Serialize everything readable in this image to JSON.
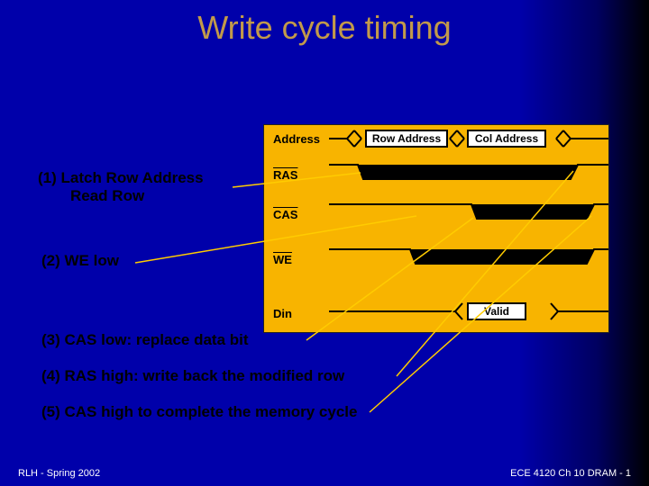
{
  "title": "Write cycle timing",
  "signals": {
    "address": "Address",
    "row_addr_box": "Row Address",
    "col_addr_box": "Col Address",
    "ras": "RAS",
    "cas": "CAS",
    "we": "WE",
    "din": "Din",
    "valid_box": "Valid"
  },
  "annotations": {
    "a1_main": "(1) Latch Row Address",
    "a1_sub": "Read Row",
    "a2": "(2) WE low",
    "a3": "(3) CAS low: replace data bit",
    "a4": "(4) RAS high: write back the modified row",
    "a5": "(5) CAS high to complete the memory cycle"
  },
  "footer": {
    "left": "RLH - Spring 2002",
    "right": "ECE 4120 Ch 10 DRAM - 1"
  },
  "chart_data": {
    "type": "timing-diagram",
    "signals": [
      {
        "name": "Address",
        "type": "bus",
        "segments": [
          {
            "t0": 0.0,
            "t1": 0.1,
            "value": "idle"
          },
          {
            "t0": 0.1,
            "t1": 0.48,
            "value": "Row Address"
          },
          {
            "t0": 0.48,
            "t1": 0.82,
            "value": "Col Address"
          },
          {
            "t0": 0.82,
            "t1": 1.0,
            "value": "idle"
          }
        ]
      },
      {
        "name": "RAS",
        "active_low": true,
        "type": "level",
        "segments": [
          {
            "t0": 0.0,
            "t1": 0.12,
            "level": "high"
          },
          {
            "t0": 0.12,
            "t1": 0.88,
            "level": "low"
          },
          {
            "t0": 0.88,
            "t1": 1.0,
            "level": "high"
          }
        ]
      },
      {
        "name": "CAS",
        "active_low": true,
        "type": "level",
        "segments": [
          {
            "t0": 0.0,
            "t1": 0.52,
            "level": "high"
          },
          {
            "t0": 0.52,
            "t1": 0.94,
            "level": "low"
          },
          {
            "t0": 0.94,
            "t1": 1.0,
            "level": "high"
          }
        ]
      },
      {
        "name": "WE",
        "active_low": true,
        "type": "level",
        "segments": [
          {
            "t0": 0.0,
            "t1": 0.3,
            "level": "high"
          },
          {
            "t0": 0.3,
            "t1": 0.94,
            "level": "low"
          },
          {
            "t0": 0.94,
            "t1": 1.0,
            "level": "high"
          }
        ]
      },
      {
        "name": "Din",
        "type": "bus",
        "segments": [
          {
            "t0": 0.0,
            "t1": 0.48,
            "value": "invalid"
          },
          {
            "t0": 0.48,
            "t1": 0.8,
            "value": "Valid"
          },
          {
            "t0": 0.8,
            "t1": 1.0,
            "value": "invalid"
          }
        ]
      }
    ],
    "events": [
      {
        "id": 1,
        "desc": "Latch Row Address / Read Row",
        "edge": "RAS falling",
        "t": 0.12
      },
      {
        "id": 2,
        "desc": "WE low",
        "edge": "WE falling",
        "t": 0.3
      },
      {
        "id": 3,
        "desc": "CAS low: replace data bit",
        "edge": "CAS falling",
        "t": 0.52
      },
      {
        "id": 4,
        "desc": "RAS high: write back the modified row",
        "edge": "RAS rising",
        "t": 0.88
      },
      {
        "id": 5,
        "desc": "CAS high to complete the memory cycle",
        "edge": "CAS rising",
        "t": 0.94
      }
    ]
  }
}
